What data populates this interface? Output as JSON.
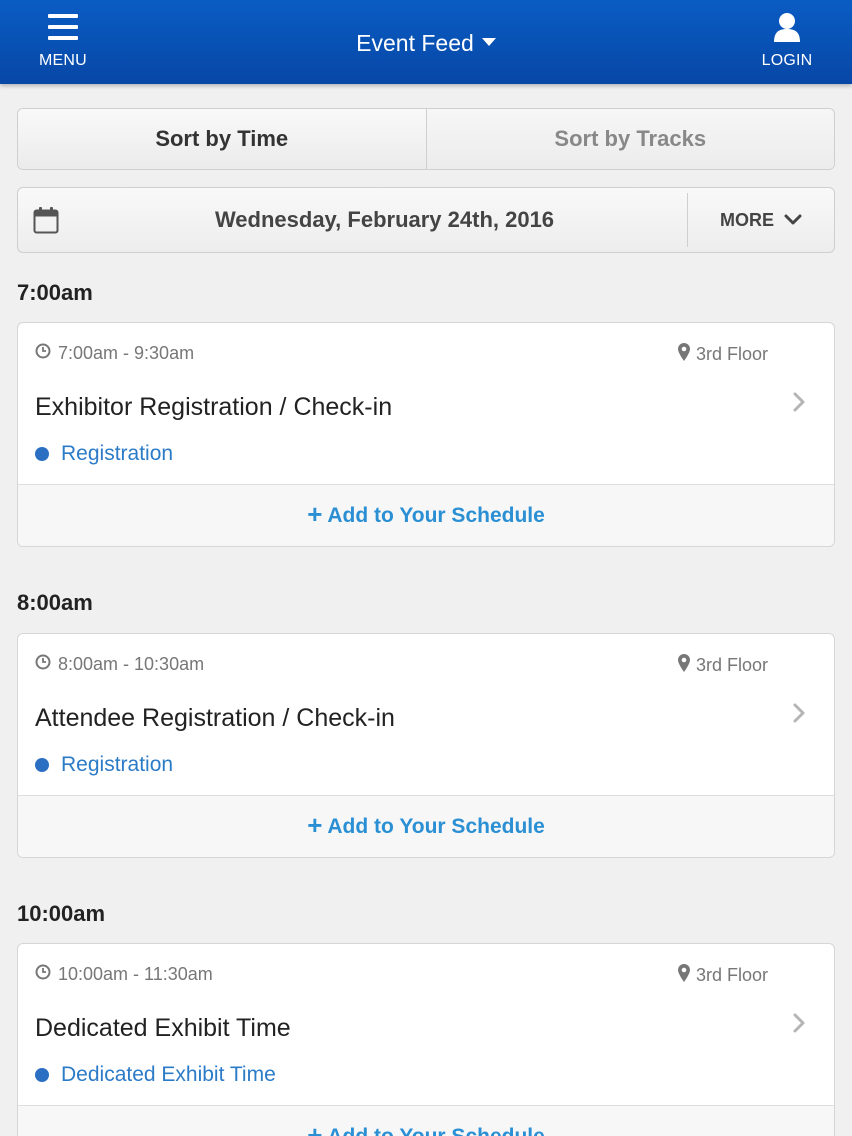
{
  "header": {
    "menu_label": "MENU",
    "title": "Event Feed",
    "login_label": "LOGIN",
    "menu_icon": "hamburger-icon",
    "login_icon": "user-icon",
    "background": "#0a5cc4"
  },
  "sort": {
    "time_label": "Sort by Time",
    "tracks_label": "Sort by Tracks",
    "active": "time"
  },
  "datebar": {
    "date": "Wednesday, February 24th, 2016",
    "more_label": "MORE",
    "calendar_icon": "calendar-icon"
  },
  "groups": [
    {
      "heading": "7:00am",
      "session": {
        "time": "7:00am - 9:30am",
        "location": "3rd Floor",
        "title": "Exhibitor Registration / Check-in",
        "track": "Registration",
        "add_label": "Add to Your Schedule"
      }
    },
    {
      "heading": "8:00am",
      "session": {
        "time": "8:00am - 10:30am",
        "location": "3rd Floor",
        "title": "Attendee Registration / Check-in",
        "track": "Registration",
        "add_label": "Add to Your Schedule"
      }
    },
    {
      "heading": "10:00am",
      "session": {
        "time": "10:00am - 11:30am",
        "location": "3rd Floor",
        "title": "Dedicated Exhibit Time",
        "track": "Dedicated Exhibit Time",
        "add_label": "Add to Your Schedule"
      }
    }
  ],
  "colors": {
    "accent_link": "#2b8fd4",
    "track_dot": "#2a6fc1"
  }
}
